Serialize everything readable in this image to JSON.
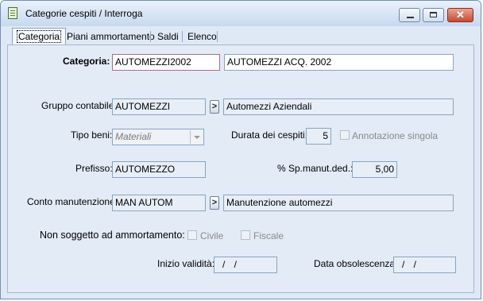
{
  "window": {
    "title": "Categorie cespiti / Interroga",
    "minimize_icon": "minimize-icon",
    "maximize_icon": "maximize-icon",
    "close_icon": "close-icon",
    "close_glyph": "✕"
  },
  "tabs": [
    {
      "label": "Categoria",
      "active": true
    },
    {
      "label": "Piani ammortamento",
      "active": false
    },
    {
      "label": "Saldi",
      "active": false
    },
    {
      "label": "Elenco",
      "active": false
    }
  ],
  "form": {
    "categoria": {
      "label": "Categoria:",
      "code": "AUTOMEZZI2002",
      "description": "AUTOMEZZI ACQ. 2002"
    },
    "gruppo_contabile": {
      "label": "Gruppo contabile:",
      "code": "AUTOMEZZI",
      "description": "Automezzi Aziendali",
      "lookup_glyph": ">"
    },
    "tipo_beni": {
      "label": "Tipo beni:",
      "value": "Materiali"
    },
    "durata_cespiti": {
      "label": "Durata dei cespiti:",
      "value": "5"
    },
    "annotazione_singola": {
      "label": "Annotazione singola",
      "checked": false
    },
    "prefisso": {
      "label": "Prefisso:",
      "value": "AUTOMEZZO"
    },
    "sp_manut": {
      "label": "% Sp.manut.ded.:",
      "value": "5,00"
    },
    "conto_manutenzione": {
      "label": "Conto manutenzione:",
      "code": "MAN AUTOM",
      "description": "Manutenzione automezzi",
      "lookup_glyph": ">"
    },
    "non_soggetto": {
      "label": "Non soggetto ad ammortamento:",
      "civile": {
        "label": "Civile",
        "checked": false
      },
      "fiscale": {
        "label": "Fiscale",
        "checked": false
      }
    },
    "inizio_validita": {
      "label": "Inizio validità:",
      "value": "/ /"
    },
    "data_obsolescenza": {
      "label": "Data obsolescenza:",
      "value": "/ /"
    }
  }
}
